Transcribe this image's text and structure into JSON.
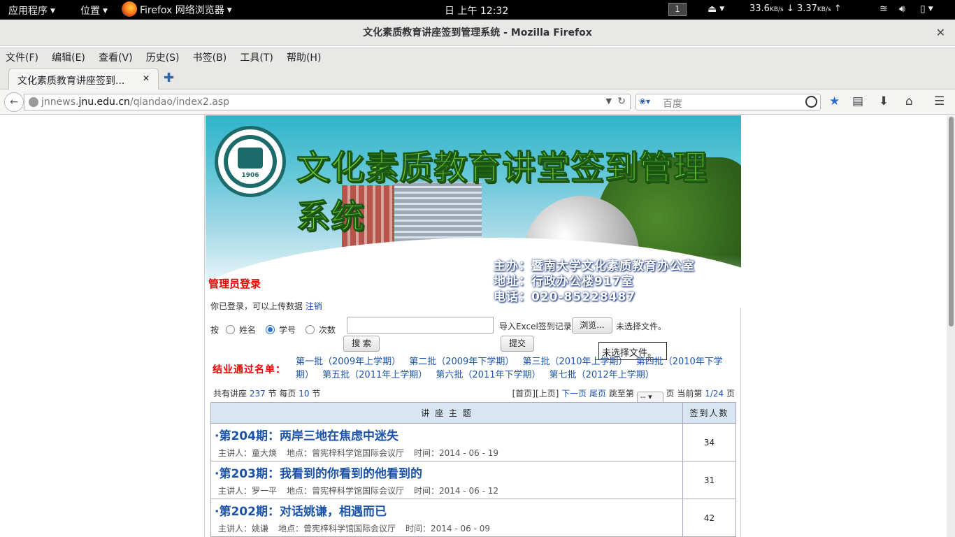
{
  "topbar": {
    "apps": "应用程序",
    "places": "位置",
    "app_name": "Firefox 网络浏览器",
    "clock": "日 上午 12:32",
    "workspace": "1",
    "net_down": "33.6",
    "net_down_unit": "KB/s",
    "net_up": "3.37",
    "net_up_unit": "KB/s"
  },
  "window": {
    "title": "文化素质教育讲座签到管理系统 - Mozilla Firefox"
  },
  "menu": [
    "文件(F)",
    "编辑(E)",
    "查看(V)",
    "历史(S)",
    "书签(B)",
    "工具(T)",
    "帮助(H)"
  ],
  "tab": {
    "label": "文化素质教育讲座签到..."
  },
  "nav": {
    "url_prefix": "jnnews.",
    "url_domain": "jnu.edu.cn",
    "url_path": "/qiandao/index2.asp",
    "search_placeholder": "百度"
  },
  "banner": {
    "system_title": "文化素质教育讲堂签到管理系统",
    "emblem_year": "1906",
    "sponsor": "主办：暨南大学文化素质教育办公室",
    "address": "地址：行政办公楼917室",
    "phone": "电话：020-85228487"
  },
  "admin": {
    "title": "管理员登录",
    "status": "你已登录，可以上传数据",
    "logout": "注销"
  },
  "search": {
    "by": "按",
    "options": [
      "姓名",
      "学号",
      "次数"
    ],
    "selected": "学号",
    "button": "搜 索",
    "import_label": "导入Excel签到记录",
    "browse": "浏览...",
    "no_file": "未选择文件。",
    "submit": "提交",
    "tooltip": "未选择文件。"
  },
  "graduates": {
    "label": "结业通过名单：",
    "batches": [
      "第一批（2009年上学期）",
      "第二批（2009年下学期）",
      "第三批（2010年上学期）",
      "第四批（2010年下学期）",
      "第五批（2011年上学期）",
      "第六批（2011年下学期）",
      "第七批（2012年上学期）"
    ]
  },
  "pager": {
    "prefix": "共有讲座",
    "total": "237",
    "mid": "节 每页",
    "per_page": "10",
    "suffix": "节",
    "first": "[首页]",
    "prev": "[上页]",
    "next": "下一页",
    "last": "尾页",
    "jump": "跳至第",
    "select": "--",
    "page_word": "页",
    "current_label": "当前第",
    "current": "1/24",
    "current_suffix": "页"
  },
  "table": {
    "headers": [
      "讲 座 主 题",
      "签到人数"
    ],
    "rows": [
      {
        "title": "·第204期：两岸三地在焦虑中迷失",
        "speaker": "主讲人：童大焕",
        "place": "地点：曾宪梓科学馆国际会议厅",
        "time": "时间：2014 - 06 - 19",
        "count": "34"
      },
      {
        "title": "·第203期：我看到的你看到的他看到的",
        "speaker": "主讲人：罗一平",
        "place": "地点：曾宪梓科学馆国际会议厅",
        "time": "时间：2014 - 06 - 12",
        "count": "31"
      },
      {
        "title": "·第202期：对话姚谦，相遇而已",
        "speaker": "主讲人：姚谦",
        "place": "地点：曾宪梓科学馆国际会议厅",
        "time": "时间：2014 - 06 - 09",
        "count": "42"
      }
    ]
  }
}
